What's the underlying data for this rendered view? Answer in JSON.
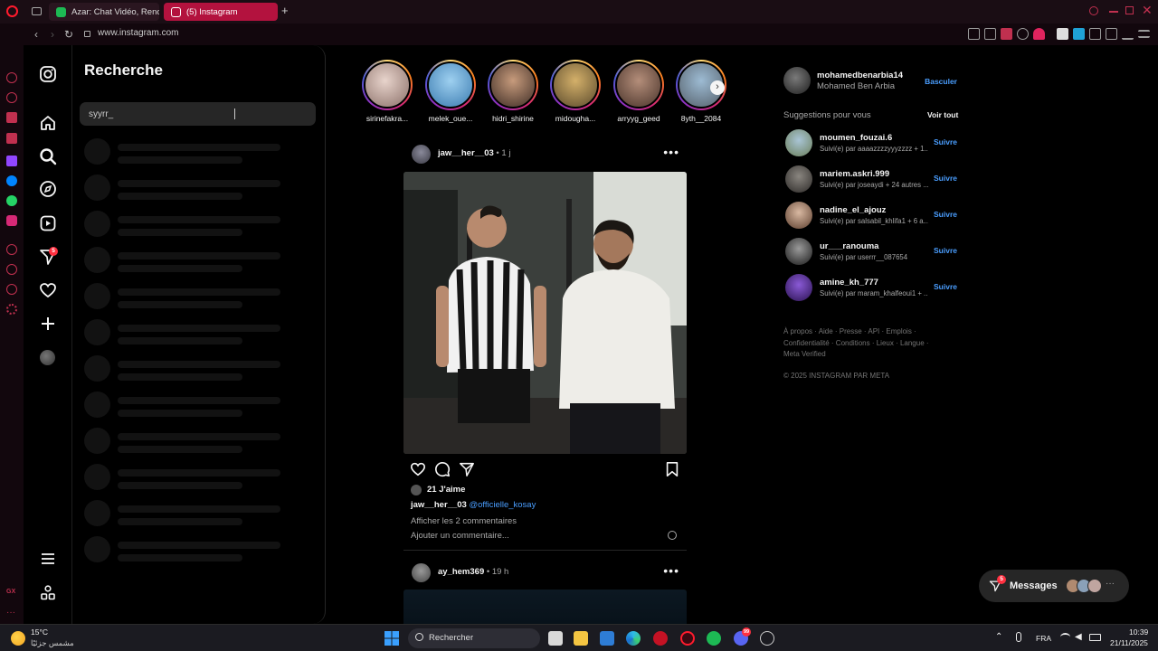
{
  "browser": {
    "tabs": [
      {
        "label": "Azar: Chat Vidéo, Rencont",
        "favicon": "azar-icon",
        "active": false
      },
      {
        "label": "(5) Instagram",
        "favicon": "instagram-icon",
        "active": true
      }
    ],
    "new_tab": "+",
    "url": "www.instagram.com"
  },
  "search_panel": {
    "title": "Recherche",
    "input_value": "syyrr_"
  },
  "nav": {
    "notifications_badge": "5"
  },
  "stories": [
    {
      "name": "sirinefakra..."
    },
    {
      "name": "melek_oue..."
    },
    {
      "name": "hidri_shirine"
    },
    {
      "name": "midougha..."
    },
    {
      "name": "arryyg_geed"
    },
    {
      "name": "8yth__2084"
    }
  ],
  "post1": {
    "user": "jaw__her__03",
    "time": " • 1 j",
    "likes": "21 J'aime",
    "caption_user": "jaw__her__03",
    "caption_mention": "@officielle_kosay",
    "view_comments": "Afficher les 2 commentaires",
    "add_comment": "Ajouter un commentaire..."
  },
  "post2": {
    "user": "ay_hem369",
    "time": " • 19 h"
  },
  "profile": {
    "username": "mohamedbenarbia14",
    "fullname": "Mohamed Ben Arbia",
    "switch_label": "Basculer"
  },
  "suggestions": {
    "title": "Suggestions pour vous",
    "see_all": "Voir tout",
    "follow_label": "Suivre",
    "items": [
      {
        "name": "moumen_fouzai.6",
        "sub": "Suivi(e) par aaaazzzzyyyzzzz + 1..."
      },
      {
        "name": "mariem.askri.999",
        "sub": "Suivi(e) par joseaydi + 24 autres ..."
      },
      {
        "name": "nadine_el_ajouz",
        "sub": "Suivi(e) par salsabil_khlifa1 + 6 a..."
      },
      {
        "name": "ur___ranouma",
        "sub": "Suivi(e) par userrr__087654"
      },
      {
        "name": "amine_kh_777",
        "sub": "Suivi(e) par maram_khalfeoui1 + ..."
      }
    ]
  },
  "footer": {
    "line1": "À propos · Aide · Presse · API · Emplois ·",
    "line2": "Confidentialité · Conditions · Lieux · Langue ·",
    "line3": "Meta Verified",
    "copyright": "© 2025 INSTAGRAM PAR META"
  },
  "messages": {
    "label": "Messages",
    "badge": "5"
  },
  "taskbar": {
    "weather_temp": "15°C",
    "weather_desc": "مشمس جزئيًا",
    "search_placeholder": "Rechercher",
    "discord_badge": "99",
    "language": "FRA",
    "time": "10:39",
    "date": "21/11/2025"
  },
  "colors": {
    "accent_link": "#4a9eff",
    "opera_red": "#b3123e",
    "badge_red": "#ff3040"
  }
}
